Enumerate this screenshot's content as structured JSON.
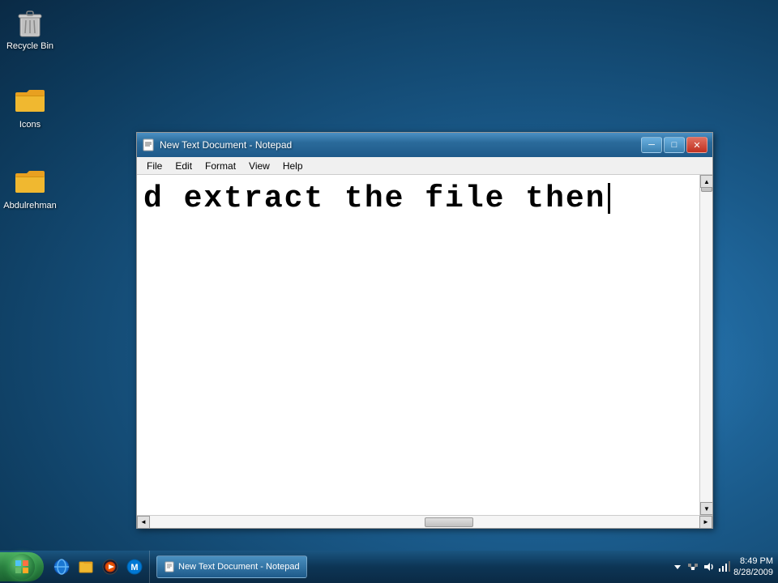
{
  "desktop": {
    "background_color": "#1a5a8a"
  },
  "recycle_bin": {
    "label": "Recycle Bin",
    "icon": "recycle-bin"
  },
  "icons_folder": {
    "label": "Icons",
    "icon": "folder"
  },
  "abdulrehman_folder": {
    "label": "Abdulrehman",
    "icon": "folder"
  },
  "notepad": {
    "title": "New Text Document - Notepad",
    "menu": {
      "file": "File",
      "edit": "Edit",
      "format": "Format",
      "view": "View",
      "help": "Help"
    },
    "content": "d extract the file then",
    "window_buttons": {
      "minimize": "─",
      "maximize": "□",
      "close": "✕"
    }
  },
  "taskbar": {
    "active_window": "New Text Document - Notepad",
    "time": "8:49 PM",
    "date": "8/28/2009"
  }
}
